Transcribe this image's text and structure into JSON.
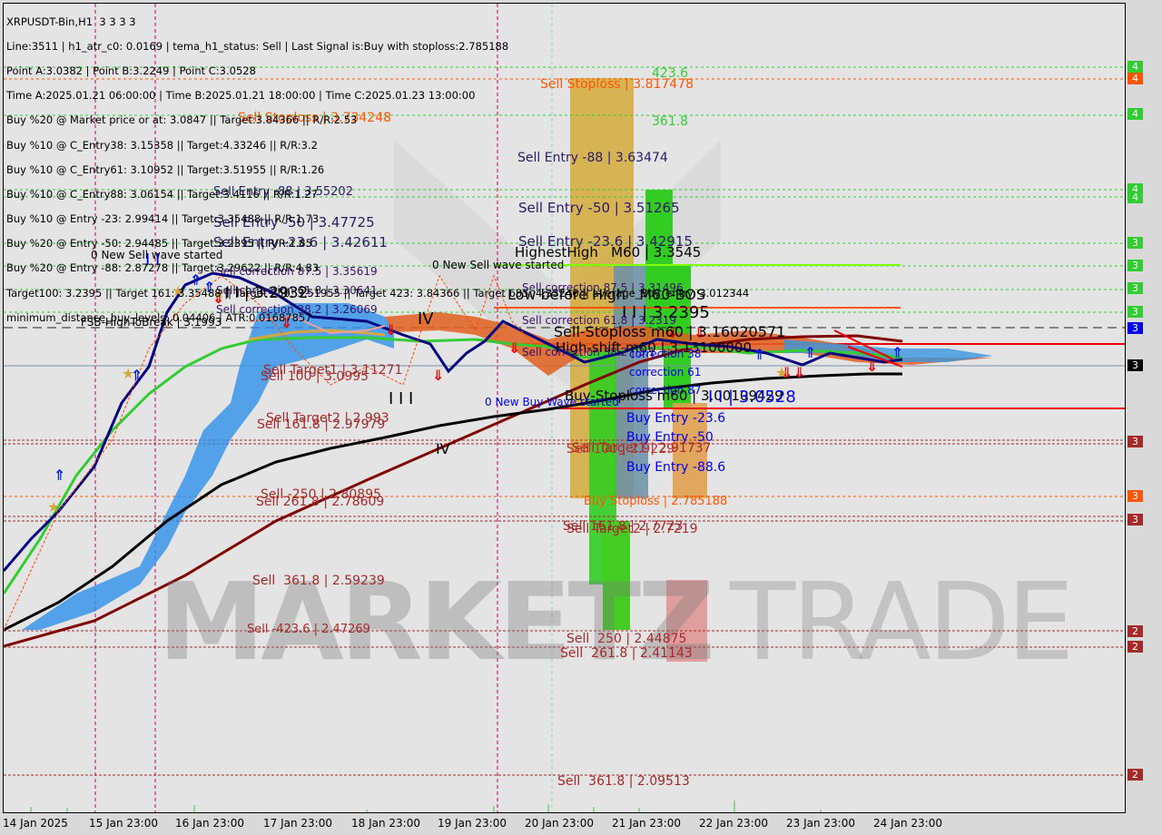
{
  "header": {
    "symbol": "XRPUSDT-Bin,H1  3 3 3 3",
    "lines": [
      "Line:3511 | h1_atr_c0: 0.0169 | tema_h1_status: Sell | Last Signal is:Buy with stoploss:2.785188",
      "Point A:3.0382 | Point B:3.2249 | Point C:3.0528",
      "Time A:2025.01.21 06:00:00 | Time B:2025.01.21 18:00:00 | Time C:2025.01.23 13:00:00",
      "Buy %20 @ Market price or at: 3.0847 || Target:3.84366 || R/R:2.53",
      "Buy %10 @ C_Entry38: 3.15358 || Target:4.33246 || R/R:3.2",
      "Buy %10 @ C_Entry61: 3.10952 || Target:3.51955 || R/R:1.26",
      "Buy %10 @ C_Entry88: 3.06154 || Target:3.4116 || R/R:1.27",
      "Buy %10 @ Entry -23: 2.99414 || Target:3.35488 || R/R:1.73",
      "Buy %20 @ Entry -50: 2.94485 || Target:3.2395 || R/R:1.85",
      "Buy %20 @ Entry -88: 2.87278 || Target:3.29622 || R/R:4.83",
      "Target100: 3.2395 || Target 161: 3.35488 || Target 250: 3.51955 || Target 423: 3.84366 || Target 685: 4.33246 || average_Buy_entry: 3.012344",
      "minimum_distance_buy_levels: 0.04406 | ATR:0.01687857"
    ]
  },
  "chart_data": {
    "type": "candlestick-overlay",
    "title": "XRPUSDT-Bin,H1",
    "x_ticks": [
      "14 Jan 2025",
      "15 Jan 23:00",
      "16 Jan 23:00",
      "17 Jan 23:00",
      "18 Jan 23:00",
      "19 Jan 23:00",
      "20 Jan 23:00",
      "21 Jan 23:00",
      "22 Jan 23:00",
      "23 Jan 23:00",
      "24 Jan 23:00"
    ],
    "price_axis_labels": [
      {
        "text": "4",
        "color": "#33cc33"
      },
      {
        "text": "4",
        "color": "#ff5500"
      },
      {
        "text": "4",
        "color": "#33cc33"
      },
      {
        "text": "4",
        "color": "#33cc33"
      },
      {
        "text": "4",
        "color": "#33cc33"
      },
      {
        "text": "3",
        "color": "#33cc33"
      },
      {
        "text": "3",
        "color": "#33cc33"
      },
      {
        "text": "3",
        "color": "#33cc33"
      },
      {
        "text": "3",
        "color": "#33cc33"
      },
      {
        "text": "3",
        "color": "#0000ee"
      },
      {
        "text": "3",
        "color": "#000000"
      },
      {
        "text": "3",
        "color": "#a52a2a"
      },
      {
        "text": "3",
        "color": "#ff5500"
      },
      {
        "text": "3",
        "color": "#a52a2a"
      },
      {
        "text": "2",
        "color": "#a52a2a"
      },
      {
        "text": "2",
        "color": "#a52a2a"
      },
      {
        "text": "2",
        "color": "#a52a2a"
      }
    ],
    "annotations": [
      "Sell Stoploss | 3.817478",
      "423.6",
      "361.8",
      "Sell Stoploss | 3.734248",
      "Sell Entry -88 | 3.63474",
      "Sell Entry -88 | 3.55202",
      "Sell Entry -50 | 3.51265",
      "Sell Entry -50 | 3.47725",
      "Sell Entry -23.6 | 3.42915",
      "Sell Entry -23.6 | 3.42611",
      "HighestHigh   M60 | 3.3545",
      "0 New Sell wave started",
      "0 New Sell wave started",
      "Sell correction 87.5 | 3.35619",
      "Sell correction 87.5 | 3.31496",
      "Sell correction 61.8 | 3.30641",
      "Low before High   M60-BOS",
      "I I | 3.2932",
      "Sell correction 38.2 | 3.26069",
      "I I | 3.2395",
      "FSB-HighToBreak | 3.1993",
      "Sell correction 61.8 | 3.2319",
      "Sell-Stoploss m60 | 3.16020571",
      "IV",
      "High-shift m60 | 3.13100000",
      "Sell correction 38.2 | 3.1",
      "correction 38",
      "correction 61",
      "Sell Target1 | 3.11271",
      "Sell 100 | 3.0995",
      "correction 87",
      "Buy-Stoploss m60 | 3.00109429",
      "I I | 3.0528",
      "0 New Buy Wave started",
      "I I I",
      "Buy Entry -23.6",
      "Sell Target2 | 2.993",
      "Sell 161.8 | 2.97979",
      "IV",
      "Buy Entry -50",
      "Sell Target1 | 2.91737",
      "Sell 100 | 2.9229",
      "Buy Entry -88.6",
      "Sell -250 | 2.80895",
      "Sell 261.8 | 2.78609",
      "Buy Stoploss | 2.785188",
      "Sell 161.8 | 2.7723",
      "Sell Target2 | 2.7219",
      "Sell  361.8 | 2.59239",
      "Sell -423.6 | 2.47269",
      "Sell  250 | 2.44875",
      "Sell  261.8 | 2.41143",
      "Sell  361.8 | 2.09513",
      "I I"
    ],
    "colors": {
      "background": "#e4e4e4",
      "sell_levels": "#33cc33",
      "stoploss": "#ff5500",
      "targets": "#a52a2a",
      "buy_entries": "#0000ee",
      "ema_fast": "#000080",
      "ema_mid": "#33cc33",
      "ema_slow": "#000000",
      "ema_slowest": "#800000"
    }
  },
  "watermark": {
    "left": "MARKETZ",
    "right": "TRADE"
  }
}
